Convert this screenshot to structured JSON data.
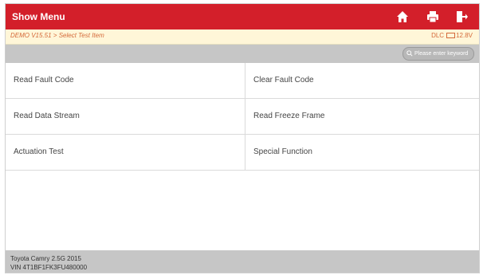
{
  "header": {
    "title": "Show Menu"
  },
  "icons": [
    "home-icon",
    "print-icon",
    "exit-icon"
  ],
  "subheader": {
    "breadcrumb": "DEMO V15.51 > Select Test Item",
    "dlc": "DLC",
    "voltage": "12.8V"
  },
  "search": {
    "placeholder": "Please enter keyword"
  },
  "menu": {
    "items": [
      {
        "label": "Read Fault Code"
      },
      {
        "label": "Clear Fault Code"
      },
      {
        "label": "Read Data Stream"
      },
      {
        "label": "Read Freeze Frame"
      },
      {
        "label": "Actuation Test"
      },
      {
        "label": "Special Function"
      }
    ]
  },
  "footer": {
    "vehicle": "Toyota Camry 2.5G 2015",
    "vin": "VIN 4T1BF1FK3FU480000"
  },
  "colors": {
    "titlebar": "#d31f2a",
    "subbar": "#fff6d8",
    "accent": "#d46a3a",
    "bar_gray": "#c6c6c6"
  }
}
